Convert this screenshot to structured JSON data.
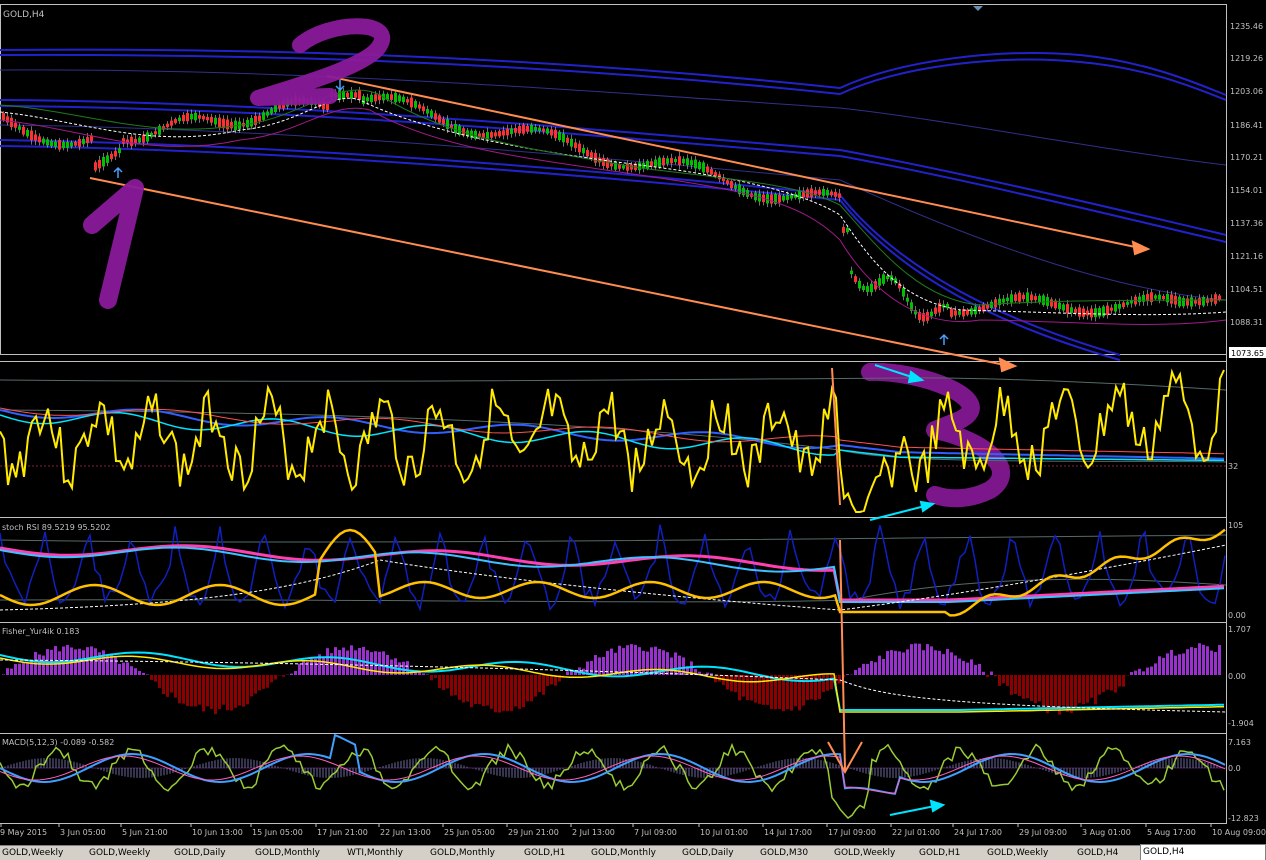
{
  "main": {
    "title": "GOLD,H4",
    "price_labels": [
      "1235.46",
      "1219.26",
      "1203.06",
      "1186.41",
      "1170.21",
      "1154.01",
      "1137.36",
      "1121.16",
      "1104.51",
      "1088.31"
    ],
    "current_price": "1073.65",
    "annotations": {
      "wave1": "1",
      "wave2": "2",
      "wave3": "3"
    }
  },
  "panels": [
    {
      "id": "osc1",
      "label": "",
      "scale": [
        "32"
      ]
    },
    {
      "id": "stoch-rsi",
      "label": "stoch RSI 89.5219 95.5202",
      "scale": [
        "105",
        "0.00"
      ]
    },
    {
      "id": "fisher",
      "label": "Fisher_Yur4ik 0.183",
      "scale": [
        "1.707",
        "0.00",
        "-1.904"
      ]
    },
    {
      "id": "macd",
      "label": "MACD(5,12,3) -0.089 -0.582",
      "scale": [
        "7.163",
        "0.0",
        "-12.823"
      ]
    }
  ],
  "time_axis": [
    "9 May 2015",
    "3 Jun 05:00",
    "5 Jun 21:00",
    "10 Jun 13:00",
    "15 Jun 05:00",
    "17 Jun 21:00",
    "22 Jun 13:00",
    "25 Jun 05:00",
    "29 Jun 21:00",
    "2 Jul 13:00",
    "7 Jul 09:00",
    "10 Jul 01:00",
    "14 Jul 17:00",
    "17 Jul 09:00",
    "22 Jul 01:00",
    "24 Jul 17:00",
    "29 Jul 09:00",
    "3 Aug 01:00",
    "5 Aug 17:00",
    "10 Aug 09:00"
  ],
  "tabs": [
    "GOLD,Weekly",
    "GOLD,Weekly",
    "GOLD,Daily",
    "GOLD,Monthly",
    "WTI,Monthly",
    "GOLD,Monthly",
    "GOLD,H1",
    "GOLD,Monthly",
    "GOLD,Daily",
    "GOLD,M30",
    "GOLD,Weekly",
    "GOLD,H1",
    "GOLD,Weekly",
    "GOLD,H4",
    "GOLD,H4"
  ],
  "active_tab": 14,
  "colors": {
    "background": "#000000",
    "axis": "#c0c0c0",
    "bull": "#00c000",
    "bear": "#ff3030",
    "band": "#2222cc",
    "trend": "#ff8c50",
    "annotation": "#8a1a9a",
    "osc_main": "#ffea00",
    "cyan": "#00e5ff",
    "pink": "#ff40b0",
    "hist_pos": "#9932cc",
    "hist_neg": "#8b0000",
    "macd_line": "#9acd32"
  }
}
